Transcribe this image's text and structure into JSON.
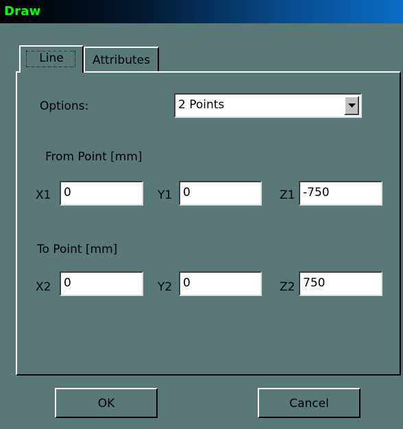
{
  "window": {
    "title": "Draw"
  },
  "tabs": [
    {
      "label": "Line",
      "selected": true
    },
    {
      "label": "Attributes",
      "selected": false
    }
  ],
  "options": {
    "label": "Options:",
    "selected_value": "2 Points"
  },
  "from_point": {
    "heading": "From Point [mm]",
    "fields": [
      {
        "label": "X1",
        "value": "0"
      },
      {
        "label": "Y1",
        "value": "0"
      },
      {
        "label": "Z1",
        "value": "-750"
      }
    ]
  },
  "to_point": {
    "heading": "To Point [mm]",
    "fields": [
      {
        "label": "X2",
        "value": "0"
      },
      {
        "label": "Y2",
        "value": "0"
      },
      {
        "label": "Z2",
        "value": "750"
      }
    ]
  },
  "buttons": {
    "ok_label": "OK",
    "cancel_label": "Cancel"
  },
  "colors": {
    "title_text": "#00ff00",
    "dialog_background": "#5a7878",
    "titlebar_gradient_end": "#0a6cc6"
  }
}
